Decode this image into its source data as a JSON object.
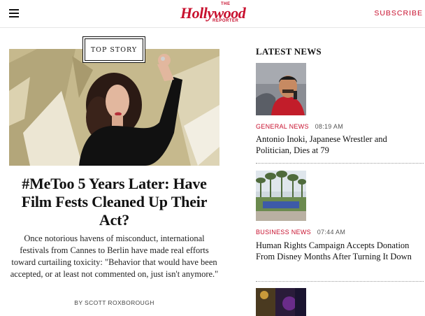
{
  "header": {
    "logo_the": "THE",
    "logo_name": "Hollywood",
    "logo_reporter": "REPORTER",
    "subscribe_label": "SUBSCRIBE"
  },
  "top_story": {
    "badge": "TOP STORY",
    "headline": "#MeToo 5 Years Later: Have Film Fests Cleaned Up Their Act?",
    "dek": "Once notorious havens of misconduct, international festivals from Cannes to Berlin have made real efforts toward curtailing toxicity: \"Behavior that would have been accepted, or at least not commented on, just isn't anymore.\"",
    "byline": "BY SCOTT ROXBOROUGH"
  },
  "latest_news": {
    "title": "LATEST NEWS",
    "items": [
      {
        "category": "GENERAL NEWS",
        "time": "08:19 AM",
        "title": "Antonio Inoki, Japanese Wrestler and Politician, Dies at 79"
      },
      {
        "category": "BUSINESS NEWS",
        "time": "07:44 AM",
        "title": "Human Rights Campaign Accepts Donation From Disney Months After Turning It Down"
      },
      {
        "category": "",
        "time": "",
        "title": ""
      }
    ]
  },
  "colors": {
    "brand_red": "#c8102e",
    "hero_bg": "#c9bd93"
  }
}
